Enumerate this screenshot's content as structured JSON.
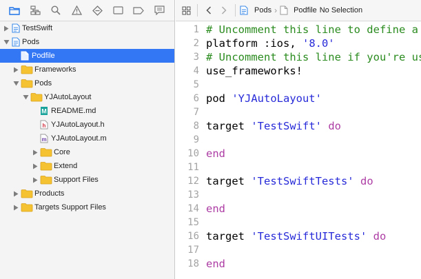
{
  "navigator": {
    "toolbar_icons": [
      "folder-icon",
      "hierarchy-icon",
      "search-icon",
      "warning-icon",
      "diamond-icon",
      "tests-icon",
      "breakpoint-icon",
      "comment-icon"
    ],
    "tree": [
      {
        "label": "TestSwift",
        "depth": 0,
        "expanded": false,
        "icon": "project-icon",
        "selected": false
      },
      {
        "label": "Pods",
        "depth": 0,
        "expanded": true,
        "icon": "project-icon",
        "selected": false
      },
      {
        "label": "Podfile",
        "depth": 1,
        "expanded": null,
        "icon": "file-icon",
        "selected": true
      },
      {
        "label": "Frameworks",
        "depth": 1,
        "expanded": false,
        "icon": "folder-icon",
        "selected": false
      },
      {
        "label": "Pods",
        "depth": 1,
        "expanded": true,
        "icon": "folder-icon",
        "selected": false
      },
      {
        "label": "YJAutoLayout",
        "depth": 2,
        "expanded": true,
        "icon": "folder-icon",
        "selected": false
      },
      {
        "label": "README.md",
        "depth": 3,
        "expanded": null,
        "icon": "markdown-icon",
        "selected": false
      },
      {
        "label": "YJAutoLayout.h",
        "depth": 3,
        "expanded": null,
        "icon": "header-file-icon",
        "selected": false
      },
      {
        "label": "YJAutoLayout.m",
        "depth": 3,
        "expanded": null,
        "icon": "objc-file-icon",
        "selected": false
      },
      {
        "label": "Core",
        "depth": 3,
        "expanded": false,
        "icon": "folder-icon",
        "selected": false
      },
      {
        "label": "Extend",
        "depth": 3,
        "expanded": false,
        "icon": "folder-icon",
        "selected": false
      },
      {
        "label": "Support Files",
        "depth": 3,
        "expanded": false,
        "icon": "folder-icon",
        "selected": false
      },
      {
        "label": "Products",
        "depth": 1,
        "expanded": false,
        "icon": "folder-icon",
        "selected": false
      },
      {
        "label": "Targets Support Files",
        "depth": 1,
        "expanded": false,
        "icon": "folder-icon",
        "selected": false
      }
    ]
  },
  "jumpbar": {
    "crumbs": [
      {
        "label": "Pods",
        "icon": "project-icon"
      },
      {
        "label": "Podfile",
        "icon": "file-icon"
      },
      {
        "label": "No Selection",
        "icon": ""
      }
    ]
  },
  "editor": {
    "lines": [
      {
        "num": "1",
        "tokens": [
          {
            "t": "# Uncomment this line to define a global platform for your project",
            "c": "comment"
          }
        ]
      },
      {
        "num": "2",
        "tokens": [
          {
            "t": "platform :ios, ",
            "c": "plain"
          },
          {
            "t": "'8.0'",
            "c": "str"
          }
        ]
      },
      {
        "num": "3",
        "tokens": [
          {
            "t": "# Uncomment this line if you're using Swift",
            "c": "comment"
          }
        ]
      },
      {
        "num": "4",
        "tokens": [
          {
            "t": "use_frameworks!",
            "c": "plain"
          }
        ]
      },
      {
        "num": "5",
        "tokens": []
      },
      {
        "num": "6",
        "tokens": [
          {
            "t": "pod ",
            "c": "plain"
          },
          {
            "t": "'YJAutoLayout'",
            "c": "str"
          }
        ]
      },
      {
        "num": "7",
        "tokens": []
      },
      {
        "num": "8",
        "tokens": [
          {
            "t": "target ",
            "c": "plain"
          },
          {
            "t": "'TestSwift'",
            "c": "str"
          },
          {
            "t": " ",
            "c": "plain"
          },
          {
            "t": "do",
            "c": "kw"
          }
        ]
      },
      {
        "num": "9",
        "tokens": []
      },
      {
        "num": "10",
        "tokens": [
          {
            "t": "end",
            "c": "kw"
          }
        ]
      },
      {
        "num": "11",
        "tokens": []
      },
      {
        "num": "12",
        "tokens": [
          {
            "t": "target ",
            "c": "plain"
          },
          {
            "t": "'TestSwiftTests'",
            "c": "str"
          },
          {
            "t": " ",
            "c": "plain"
          },
          {
            "t": "do",
            "c": "kw"
          }
        ]
      },
      {
        "num": "13",
        "tokens": []
      },
      {
        "num": "14",
        "tokens": [
          {
            "t": "end",
            "c": "kw"
          }
        ]
      },
      {
        "num": "15",
        "tokens": []
      },
      {
        "num": "16",
        "tokens": [
          {
            "t": "target ",
            "c": "plain"
          },
          {
            "t": "'TestSwiftUITests'",
            "c": "str"
          },
          {
            "t": " ",
            "c": "plain"
          },
          {
            "t": "do",
            "c": "kw"
          }
        ]
      },
      {
        "num": "17",
        "tokens": []
      },
      {
        "num": "18",
        "tokens": [
          {
            "t": "end",
            "c": "kw"
          }
        ]
      }
    ]
  },
  "colors": {
    "selection": "#3477f5",
    "comment": "#2a8b1e",
    "keyword": "#ad3da4",
    "string": "#272ad8",
    "folder": "#f5c232",
    "project": "#3d8be8"
  }
}
